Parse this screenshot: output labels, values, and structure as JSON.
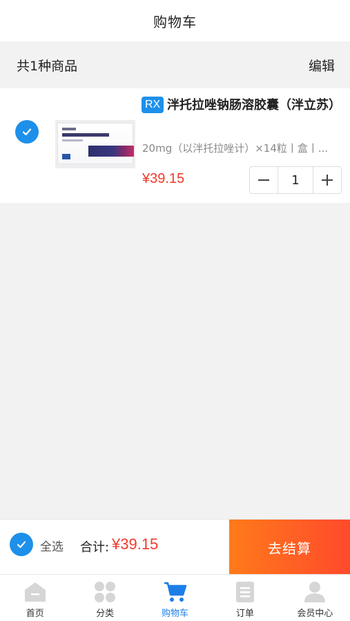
{
  "header": {
    "title": "购物车"
  },
  "summary": {
    "count_text": "共1种商品",
    "edit_label": "编辑"
  },
  "cart": {
    "items": [
      {
        "selected": true,
        "badge": "RX",
        "name": "泮托拉唑钠肠溶胶囊（泮立苏）",
        "spec": "20mg（以泮托拉唑计）×14粒丨盒丨...",
        "price": "¥39.15",
        "quantity": "1",
        "image_alt": "泮托拉唑钠肠溶胶囊"
      }
    ]
  },
  "stepper": {
    "minus": "−",
    "plus": "+"
  },
  "checkout": {
    "select_all_label": "全选",
    "select_all_checked": true,
    "total_label": "合计:",
    "total_price": "¥39.15",
    "submit_label": "去结算"
  },
  "tabbar": {
    "items": [
      {
        "label": "首页",
        "icon": "home-icon",
        "active": false
      },
      {
        "label": "分类",
        "icon": "category-icon",
        "active": false
      },
      {
        "label": "购物车",
        "icon": "cart-icon",
        "active": true
      },
      {
        "label": "订单",
        "icon": "order-icon",
        "active": false
      },
      {
        "label": "会员中心",
        "icon": "member-icon",
        "active": false
      }
    ]
  },
  "colors": {
    "accent": "#1e90ea",
    "price": "#f03a2b",
    "checkout_gradient_start": "#ff7a1a",
    "checkout_gradient_end": "#ff4a2c",
    "tab_active": "#1e7ee8",
    "tab_inactive_icon": "#d6d6d6"
  }
}
